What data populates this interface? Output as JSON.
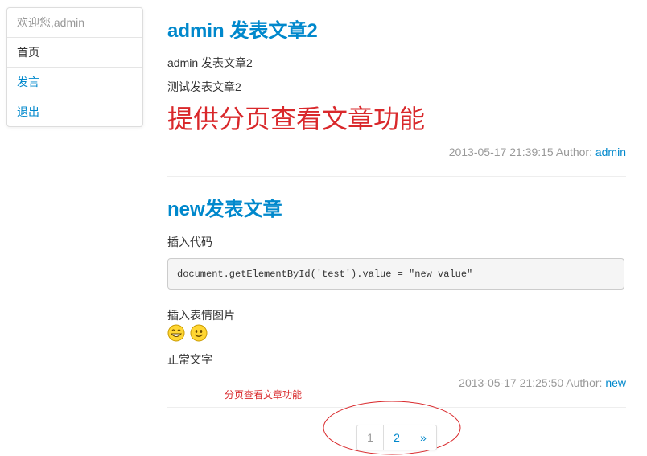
{
  "sidebar": {
    "welcome": "欢迎您,admin",
    "items": [
      {
        "label": "首页"
      },
      {
        "label": "发言"
      },
      {
        "label": "退出"
      }
    ]
  },
  "posts": [
    {
      "title": "admin 发表文章2",
      "paragraphs": [
        "admin 发表文章2",
        "测试发表文章2"
      ],
      "highlight": "提供分页查看文章功能",
      "meta": {
        "timestamp": "2013-05-17 21:39:15",
        "author_label": "Author:",
        "author": "admin"
      }
    },
    {
      "title": "new发表文章",
      "intro": "插入代码",
      "code": "document.getElementById('test').value = \"new value\"",
      "emoji_caption": "插入表情图片",
      "emojis": [
        "grin-emoji-icon",
        "smile-emoji-icon"
      ],
      "normal_text": "正常文字",
      "meta": {
        "timestamp": "2013-05-17 21:25:50",
        "author_label": "Author:",
        "author": "new"
      }
    }
  ],
  "annotation": "分页查看文章功能",
  "pagination": {
    "pages": [
      "1",
      "2"
    ],
    "current": "1",
    "next": "»"
  },
  "colors": {
    "link": "#0088cc",
    "annotation": "#d9282b",
    "muted": "#999999"
  }
}
